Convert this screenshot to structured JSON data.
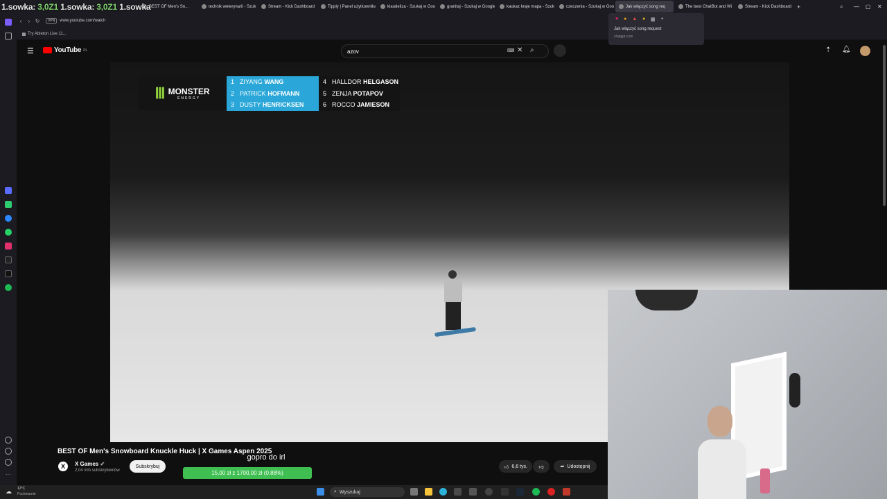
{
  "overlay": {
    "name1": "1.sowka:",
    "num1": "3,0Z1",
    "name2": "1.sowka:",
    "num2": "3,0Z1",
    "name3": "1.sowka"
  },
  "tabs": [
    {
      "label": "BEST OF Men's Sn..."
    },
    {
      "label": "technik weterynarii - Szuk"
    },
    {
      "label": "Stream - Kick Dashboard"
    },
    {
      "label": "Tipply | Panel użytkownika"
    },
    {
      "label": "klaudeliza - Szukaj w Goo"
    },
    {
      "label": "granitaj - Szukaj w Google"
    },
    {
      "label": "kaukaz kraje mapa - Szuk"
    },
    {
      "label": "czeczenia - Szukaj w Goo"
    },
    {
      "label": "Jak włączyć song req"
    },
    {
      "label": "The best ChatBot and Wi"
    },
    {
      "label": "Stream - Kick Dashboard"
    }
  ],
  "address": {
    "vpn": "VPN",
    "url": "www.youtube.com/watch"
  },
  "bookmarks": {
    "item": "Try Ableton Live 11..."
  },
  "popup": {
    "title": "Jak włączyć song request",
    "domain": "chatgpt.com"
  },
  "youtube": {
    "logo": "YouTube",
    "region": "PL",
    "search_value": "azov",
    "video": {
      "scoreboard": {
        "brand": "MONSTER",
        "brand_sub": "ENERGY",
        "left": [
          {
            "rank": "1",
            "first": "ZIYANG",
            "last": "WANG"
          },
          {
            "rank": "2",
            "first": "PATRICK",
            "last": "HOFMANN"
          },
          {
            "rank": "3",
            "first": "DUSTY",
            "last": "HENRICKSEN"
          }
        ],
        "right": [
          {
            "rank": "4",
            "first": "HALLDOR",
            "last": "HELGASON"
          },
          {
            "rank": "5",
            "first": "ZENJA",
            "last": "POTAPOV"
          },
          {
            "rank": "6",
            "first": "ROCCO",
            "last": "JAMIESON"
          }
        ]
      }
    },
    "stream_note": "gopro do irl",
    "goal": "15,00 zł z 1700,00 zł (0.88%)",
    "goal_progress": 0.0088,
    "title": "BEST OF Men's Snowboard Knuckle Huck | X Games Aspen 2025",
    "channel": {
      "avatar": "X",
      "name": "X Games",
      "subs": "2,04 mln subskrybentów",
      "subscribe_label": "Subskrybuj"
    },
    "actions": {
      "likes": "6,6 tys.",
      "share": "Udostępnij"
    }
  },
  "taskbar": {
    "temp": "12°C",
    "weather": "Pochmurnie",
    "search": "Wyszukaj"
  }
}
